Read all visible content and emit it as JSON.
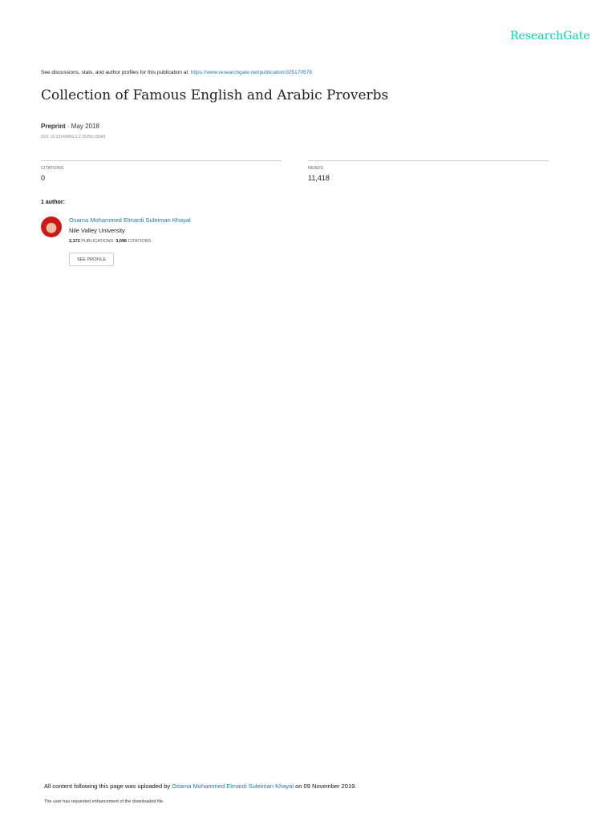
{
  "logo": "ResearchGate",
  "header": {
    "see_text": "See discussions, stats, and author profiles for this publication at:",
    "url": "https://www.researchgate.net/publication/325170578"
  },
  "title": "Collection of Famous English and Arabic Proverbs",
  "meta": {
    "type": "Preprint",
    "date": "· May 2018",
    "doi": "DOI: 10.13140/RG.2.2.15250.15043"
  },
  "stats": {
    "citations_label": "CITATIONS",
    "citations": "0",
    "reads_label": "READS",
    "reads": "11,418"
  },
  "authors_label": "1 author:",
  "author": {
    "name": "Osama Mohammed Elmardi Suleiman Khayal",
    "institution": "Nile Valley University",
    "publications": "2,172",
    "publications_label": "PUBLICATIONS",
    "citations": "3,096",
    "citations_label": "CITATIONS",
    "see_profile": "SEE PROFILE"
  },
  "footer": {
    "uploaded_prefix": "All content following this page was uploaded by",
    "uploader": "Osama Mohammed Elmardi Suleiman Khayal",
    "uploaded_suffix": "on 09 November 2019.",
    "enhancement": "The user has requested enhancement of the downloaded file."
  }
}
